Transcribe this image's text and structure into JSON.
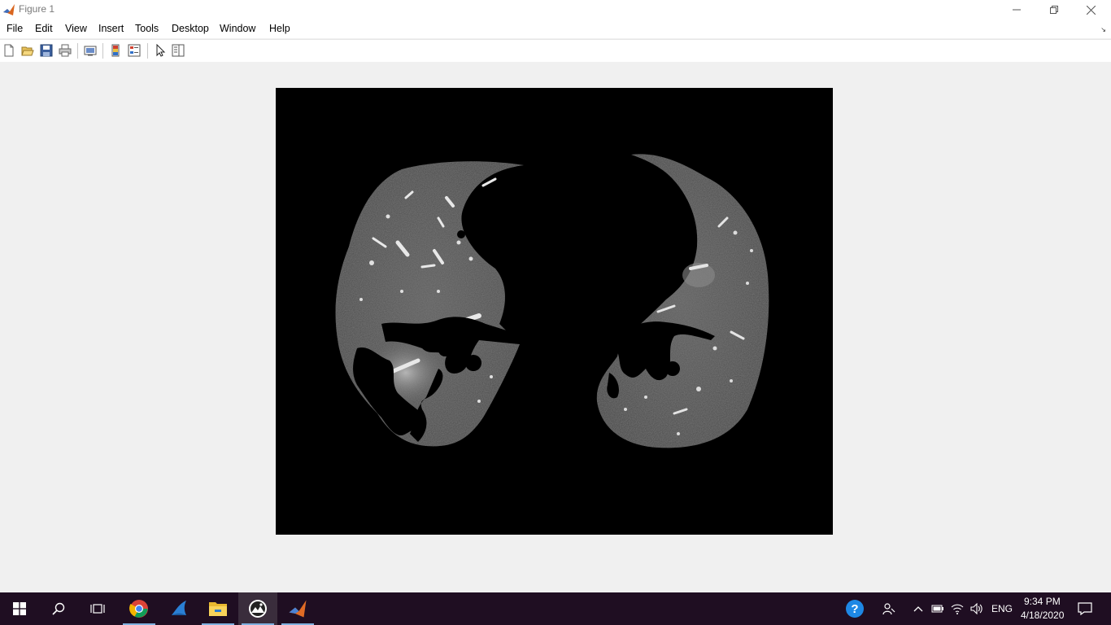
{
  "window": {
    "title": "Figure 1",
    "app_icon": "matlab-icon",
    "controls": [
      "minimize-icon",
      "restore-icon",
      "close-icon"
    ]
  },
  "menubar": {
    "items": [
      {
        "label": "File"
      },
      {
        "label": "Edit"
      },
      {
        "label": "View"
      },
      {
        "label": "Insert"
      },
      {
        "label": "Tools"
      },
      {
        "label": "Desktop"
      },
      {
        "label": "Window"
      },
      {
        "label": "Help"
      }
    ]
  },
  "toolbar": {
    "buttons": [
      "new-figure-icon",
      "open-file-icon",
      "save-icon",
      "print-icon",
      "link-plot-icon",
      "insert-colorbar-icon",
      "insert-legend-icon",
      "edit-plot-icon",
      "open-property-inspector-icon"
    ]
  },
  "figure": {
    "axes_content": "ct-lung-segmentation-image",
    "background": "#000000"
  },
  "taskbar": {
    "apps": [
      "windows-start-icon",
      "search-icon",
      "task-view-icon",
      "chrome-icon",
      "shark-app-icon",
      "file-explorer-icon",
      "image-viewer-icon",
      "matlab-icon"
    ],
    "tray": {
      "language": "ENG",
      "time": "9:34 PM",
      "date": "4/18/2020"
    }
  }
}
